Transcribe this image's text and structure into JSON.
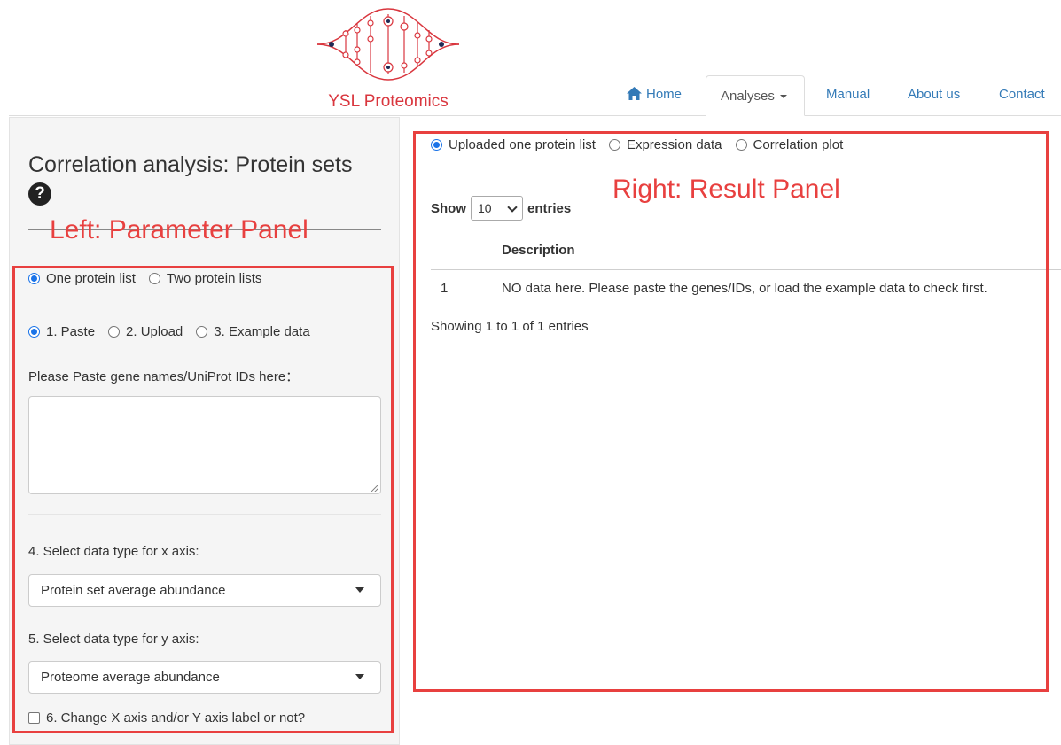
{
  "brand": {
    "name": "YSL Proteomics",
    "accent": "#d9363e"
  },
  "nav": {
    "home": "Home",
    "analyses": "Analyses",
    "manual": "Manual",
    "about": "About us",
    "contact": "Contact"
  },
  "left": {
    "title": "Correlation analysis: Protein sets",
    "help_glyph": "?",
    "list_mode": [
      "One protein list",
      "Two protein lists"
    ],
    "list_mode_selected": 0,
    "input_mode": [
      "1. Paste",
      "2. Upload",
      "3. Example data"
    ],
    "input_mode_selected": 0,
    "paste_label": "Please Paste gene names/UniProt IDs here：",
    "paste_value": "",
    "x_label": "4. Select data type for x axis:",
    "x_value": "Protein set average abundance",
    "y_label": "5. Select data type for y axis:",
    "y_value": "Proteome average abundance",
    "change_label": "6. Change X axis and/or Y axis label or not?"
  },
  "right": {
    "tabs": [
      "Uploaded one protein list",
      "Expression data",
      "Correlation plot"
    ],
    "tab_selected": 0,
    "show_label": "Show",
    "length_value": "10",
    "entries_label": "entries",
    "table": {
      "columns": [
        "",
        "Description"
      ],
      "rows": [
        [
          "1",
          "NO data here. Please paste the genes/IDs, or load the example data to check first."
        ]
      ]
    },
    "info": "Showing 1 to 1 of 1 entries"
  },
  "annotations": {
    "left": "Left: Parameter Panel",
    "right": "Right: Result Panel",
    "color": "#e8403f"
  }
}
